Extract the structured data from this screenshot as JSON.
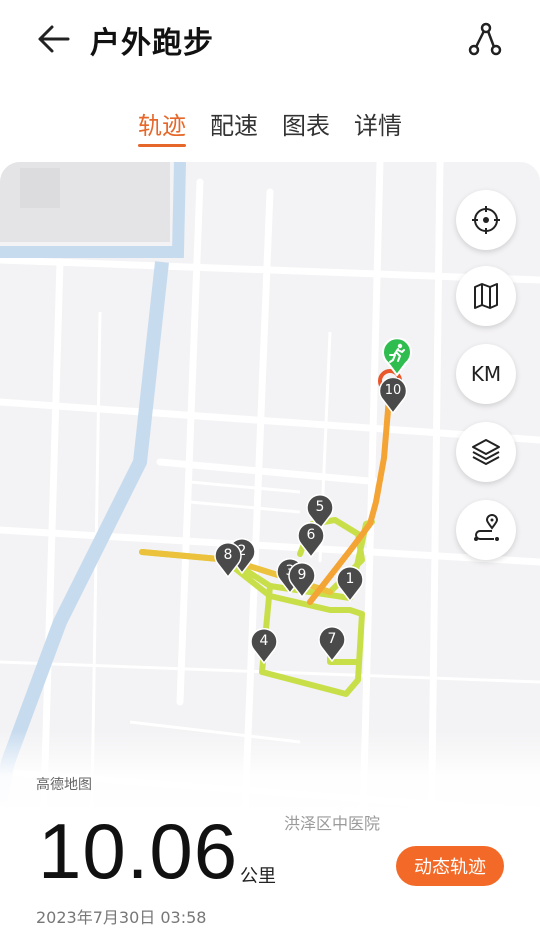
{
  "header": {
    "title": "户外跑步"
  },
  "tabs": [
    {
      "label": "轨迹",
      "active": true
    },
    {
      "label": "配速",
      "active": false
    },
    {
      "label": "图表",
      "active": false
    },
    {
      "label": "详情",
      "active": false
    }
  ],
  "map": {
    "controls": [
      {
        "name": "locate",
        "icon": "crosshair-icon"
      },
      {
        "name": "map-type",
        "icon": "map-icon"
      },
      {
        "name": "km-markers",
        "label": "KM"
      },
      {
        "name": "layers",
        "icon": "layers-icon"
      },
      {
        "name": "route",
        "icon": "route-pin-icon"
      }
    ],
    "km_markers": [
      "1",
      "2",
      "3",
      "4",
      "5",
      "6",
      "7",
      "8",
      "9",
      "10"
    ],
    "start_icon": "runner-icon",
    "provider": "高德地图",
    "poi_label": "洪泽区中医院"
  },
  "summary": {
    "distance": "10.06",
    "unit": "公里",
    "datetime": "2023年7月30日 03:58",
    "dynamic_track_label": "动态轨迹"
  },
  "colors": {
    "accent": "#e5682a",
    "button": "#f36a28",
    "track_slow": "#c9df4a",
    "track_fast": "#f3a434",
    "start": "#2fbd4f"
  }
}
